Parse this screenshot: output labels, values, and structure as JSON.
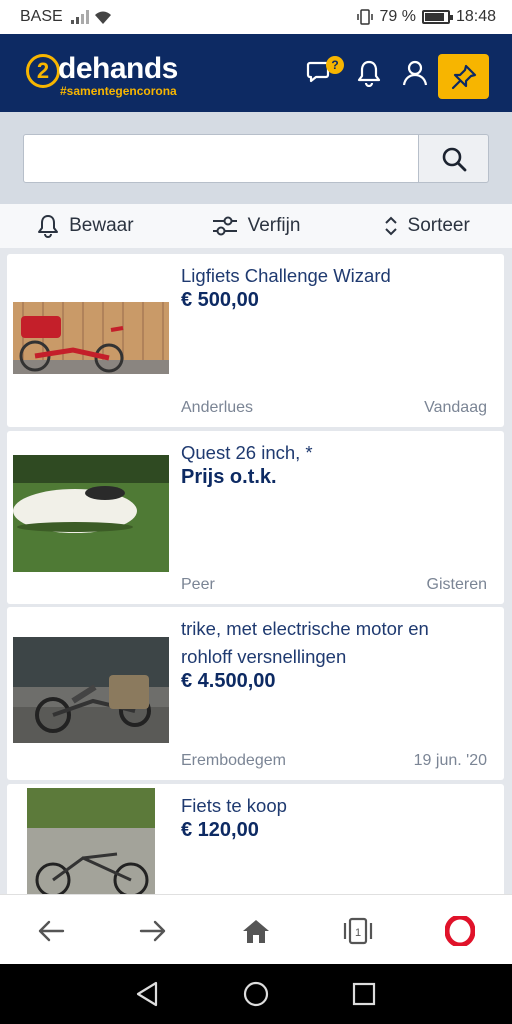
{
  "status_bar": {
    "carrier": "BASE",
    "battery_percent": "79 %",
    "battery_level": 0.79,
    "time": "18:48"
  },
  "header": {
    "logo_number": "2",
    "logo_text": "dehands",
    "logo_tagline": "#samentegencorona",
    "chat_badge": "?",
    "colors": {
      "header_bg": "#0d2a63",
      "accent": "#f7b500"
    }
  },
  "search": {
    "value": "",
    "placeholder": ""
  },
  "toolbar": {
    "save_label": "Bewaar",
    "refine_label": "Verfijn",
    "sort_label": "Sorteer"
  },
  "listings": [
    {
      "title": "Ligfiets Challenge Wizard",
      "price": "€ 500,00",
      "location": "Anderlues",
      "date": "Vandaag"
    },
    {
      "title": "Quest 26 inch, *",
      "price": "Prijs o.t.k.",
      "location": "Peer",
      "date": "Gisteren"
    },
    {
      "title": "trike, met electrische motor en rohloff versnellingen",
      "price": "€ 4.500,00",
      "location": "Erembodegem",
      "date": "19 jun. '20"
    },
    {
      "title": "Fiets te koop",
      "price": "€ 120,00",
      "location": "",
      "date": ""
    }
  ],
  "browser_nav": {
    "tab_count": "1"
  }
}
